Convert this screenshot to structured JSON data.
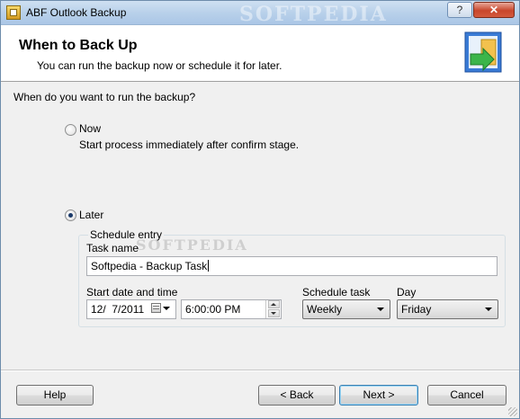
{
  "window": {
    "title": "ABF Outlook Backup",
    "watermark": "SOFTPEDIA",
    "help_btn": "?",
    "close_btn": "✕"
  },
  "header": {
    "title": "When to Back Up",
    "subtitle": "You can run the backup now or schedule it for later."
  },
  "question": "When do you want to run the backup?",
  "options": {
    "now": {
      "label": "Now",
      "description": "Start process immediately after confirm stage.",
      "checked": false
    },
    "later": {
      "label": "Later",
      "checked": true
    }
  },
  "schedule": {
    "legend": "Schedule entry",
    "watermark": "SOFTPEDIA",
    "task_name_label": "Task name",
    "task_name_value": "Softpedia - Backup Task",
    "start_label": "Start date and time",
    "date_value": "12/  7/2011",
    "time_value": "6:00:00 PM",
    "schedule_task_label": "Schedule task",
    "schedule_task_value": "Weekly",
    "day_label": "Day",
    "day_value": "Friday"
  },
  "buttons": {
    "help": "Help",
    "back": "< Back",
    "next": "Next >",
    "cancel": "Cancel"
  }
}
